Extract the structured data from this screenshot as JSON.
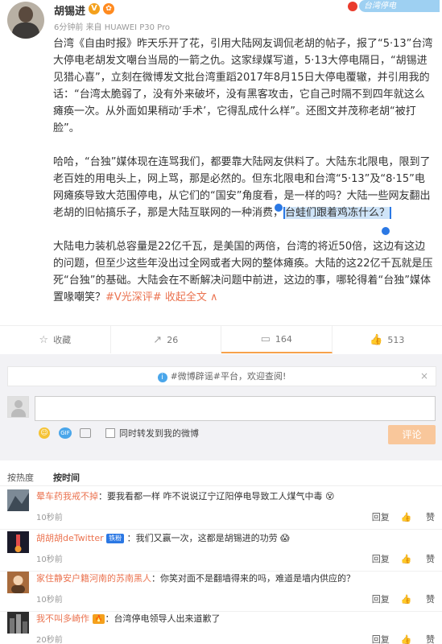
{
  "post": {
    "username": "胡锡进",
    "verified_badge": "V",
    "crown_badge": "✿",
    "time": "6分钟前",
    "source": "来自 HUAWEI P30 Pro",
    "stamp_text": "台湾停电",
    "paragraphs": [
      "台湾《自由时报》昨天乐开了花，引用大陆网友调侃老胡的帖子，报了“5·13”台湾大停电老胡发文嘲台当局的一箭之仇。这家绿媒写道，5·13大停电隔日，“胡锡进见猎心喜”，立刻在微博发文批台湾重蹈2017年8月15日大停电覆辙，并引用我的话：“台湾太脆弱了，没有外来破坏，没有黑客攻击，它自己时隔不到四年就这么瘫痪一次。从外面如果稍动‘手术’，它得乱成什么样”。还图文并茂称老胡“被打脸”。",
      "哈哈，“台独”媒体现在连骂我们，都要靠大陆网友供料了。大陆东北限电，限到了老百姓的用电头上，网上骂，那是必然的。但东北限电和台湾“5·13”及“8·15”电网瘫痪导致大范围停电，从它们的“国安”角度看，是一样的吗？大陆一些网友翻出老胡的旧帖搞乐子，那是大陆互联网的一种消费，",
      "大陆电力装机总容量是22亿千瓦，是美国的两倍，台湾的将近50倍，这边有这边的问题，但至少这些年没出过全网或者大网的整体瘫痪。大陆的这22亿千瓦就是压死“台独”的基础。大陆会在不断解决问题中前进，这边的事，哪轮得着“台独”媒体置喙嘲笑？"
    ],
    "highlighted": "台蛙们跟着鸡冻什么？",
    "tag": "#V光深评#",
    "collapse": "收起全文",
    "collapse_icon": "∧"
  },
  "actions": [
    {
      "icon": "☆",
      "label": "收藏"
    },
    {
      "icon": "↗",
      "label": "26"
    },
    {
      "icon": "▭",
      "label": "164"
    },
    {
      "icon": "👍",
      "label": "513"
    }
  ],
  "comment_box": {
    "notice": "#微博辟谣#平台，欢迎查阅!",
    "notice_close": "×",
    "repost_label": "同时转发到我的微博",
    "submit": "评论",
    "emoji_icon": "☺",
    "gif_icon": "GIF"
  },
  "sort": {
    "hot": "按热度",
    "time": "按时间"
  },
  "comments": [
    {
      "name": "晕车药我戒不掉",
      "badge": "",
      "text": "：要我看都一样 咋不说说辽宁辽阳停电导致工人煤气中毒",
      "emoji": "😵",
      "time": "10秒前",
      "reply": "回复",
      "like_icon": "👍",
      "like": "赞"
    },
    {
      "name": "胡胡胡deTwitter",
      "badge": "铁粉",
      "text": "：我们又赢一次，这都是胡锡进的功劳",
      "emoji": "😱",
      "time": "10秒前",
      "reply": "回复",
      "like_icon": "👍",
      "like": "赞"
    },
    {
      "name": "家住静安户籍河南的苏南黑人",
      "badge": "",
      "text": "：你笑对面不是翻墙得来的吗，难道是墙内供应的？",
      "emoji": "",
      "time": "10秒前",
      "reply": "回复",
      "like_icon": "👍",
      "like": "赞"
    },
    {
      "name": "我不叫多崎作",
      "badge": "🔥",
      "text": "：台湾停电领导人出来道歉了",
      "emoji": "",
      "time": "20秒前",
      "reply": "回复",
      "like_icon": "👍",
      "like": "赞"
    }
  ]
}
